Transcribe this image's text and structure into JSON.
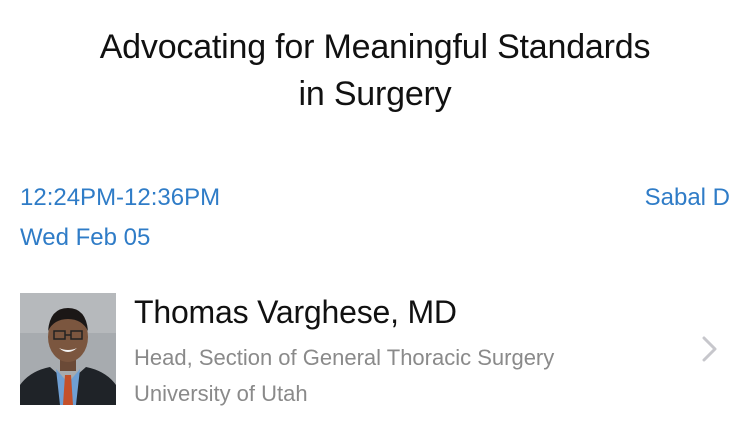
{
  "session": {
    "title_line1": "Advocating for Meaningful Standards",
    "title_line2": "in Surgery",
    "time": "12:24PM-12:36PM",
    "date": "Wed Feb 05",
    "location": "Sabal D"
  },
  "speaker": {
    "name": "Thomas Varghese, MD",
    "role": "Head, Section of General Thoracic Surgery",
    "organization": "University of Utah",
    "avatar_icon": "speaker-photo",
    "detail_icon": "chevron-right-icon"
  },
  "colors": {
    "accent": "#2f7cc7",
    "title": "#111111",
    "secondary_text": "#8a8a8a",
    "chevron": "#c7c7cc"
  }
}
